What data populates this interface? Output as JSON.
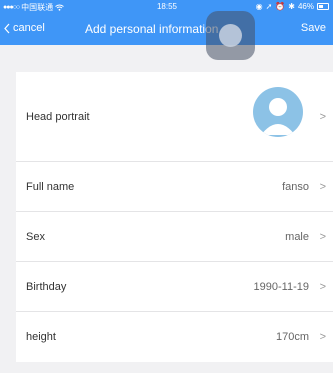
{
  "status_bar": {
    "carrier": "中国联通",
    "time": "18:55",
    "battery": "46%"
  },
  "nav": {
    "cancel_label": "cancel",
    "title": "Add personal information",
    "save_label": "Save"
  },
  "rows": [
    {
      "label": "Head portrait",
      "value": ""
    },
    {
      "label": "Full name",
      "value": "fanso"
    },
    {
      "label": "Sex",
      "value": "male"
    },
    {
      "label": "Birthday",
      "value": "1990-11-19"
    },
    {
      "label": "height",
      "value": "170cm"
    }
  ],
  "colors": {
    "nav_background": "#3f96f7",
    "page_background": "#f1f1f3",
    "avatar_background": "#8cc2e6"
  }
}
